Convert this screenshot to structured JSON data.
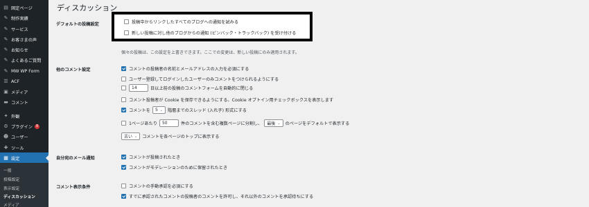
{
  "sidebar": {
    "items": [
      {
        "label": "固定ページ",
        "icon": "page-icon",
        "glyph": "▤"
      },
      {
        "label": "制作実績",
        "icon": "pin-icon",
        "glyph": "✎"
      },
      {
        "label": "サービス",
        "icon": "pin-icon",
        "glyph": "✎"
      },
      {
        "label": "お客さまの声",
        "icon": "pin-icon",
        "glyph": "✎"
      },
      {
        "label": "お知らせ",
        "icon": "pin-icon",
        "glyph": "✎"
      },
      {
        "label": "よくあるご質問",
        "icon": "pin-icon",
        "glyph": "✎"
      },
      {
        "label": "MW WP Form",
        "icon": "pin-icon",
        "glyph": "✎"
      },
      {
        "label": "ACF",
        "icon": "list-icon",
        "glyph": "☰"
      },
      {
        "label": "メディア",
        "icon": "media-icon",
        "glyph": "▣"
      },
      {
        "label": "コメント",
        "icon": "comment-icon",
        "glyph": "▬"
      },
      {
        "label": "外観",
        "icon": "appearance-icon",
        "glyph": "✦"
      },
      {
        "label": "プラグイン",
        "icon": "plugin-icon",
        "glyph": "⚙",
        "badge": "8"
      },
      {
        "label": "ユーザー",
        "icon": "user-icon",
        "glyph": "☻"
      },
      {
        "label": "ツール",
        "icon": "tool-icon",
        "glyph": "✚"
      },
      {
        "label": "設定",
        "icon": "settings-icon",
        "glyph": "▦"
      }
    ],
    "submenu": [
      "一般",
      "投稿設定",
      "表示設定",
      "ディスカッション",
      "メディア"
    ]
  },
  "page": {
    "title": "ディスカッション"
  },
  "sections": {
    "default_post": {
      "label": "デフォルトの投稿設定",
      "options": [
        {
          "label": "投稿中からリンクしたすべてのブログへの通知を試みる",
          "checked": false
        },
        {
          "label": "新しい投稿に対し他のブログからの通知 (ピンバック・トラックバック) を受け付ける",
          "checked": false
        }
      ],
      "description": "個々の投稿は、この設定を上書きできます。ここでの変更は、新しい投稿にのみ適用されます。"
    },
    "other_comments": {
      "label": "他のコメント設定",
      "opt1": "コメントの投稿者の名前とメールアドレスの入力を必須にする",
      "opt2": "ユーザー登録してログインしたユーザーのみコメントをつけられるようにする",
      "opt3_value": "14",
      "opt3_text": "日以上前の投稿のコメントフォームを自動的に閉じる",
      "opt4": "コメント投稿者が Cookie を保存できるようにする、Cookie オプトイン用チェックボックスを表示します",
      "opt5_prefix": "コメントを",
      "opt5_value": "5",
      "opt5_suffix": "階層までのスレッド (入れ子) 形式にする",
      "opt6_prefix": "1ページあたり",
      "opt6_value": "50",
      "opt6_middle": "件のコメントを含む複数ページに分割し、",
      "opt6_select": "最後",
      "opt6_suffix": "のページをデフォルトで表示する",
      "opt7_select": "古い",
      "opt7_suffix": "コメントを各ページのトップに表示する"
    },
    "email_me": {
      "label": "自分宛のメール通知",
      "opt1": "コメントが投稿されたとき",
      "opt2": "コメントがモデレーションのために保留されたとき"
    },
    "comment_appear": {
      "label": "コメント表示条件",
      "opt1": "コメントの手動承認を必須にする",
      "opt2": "すでに承認されたコメントの投稿者のコメントを許可し、それ以外のコメントを承認待ちにする"
    }
  },
  "colors": {
    "sidebar_bg": "#1d2327",
    "accent": "#2271b1",
    "highlight_border": "#000000"
  }
}
